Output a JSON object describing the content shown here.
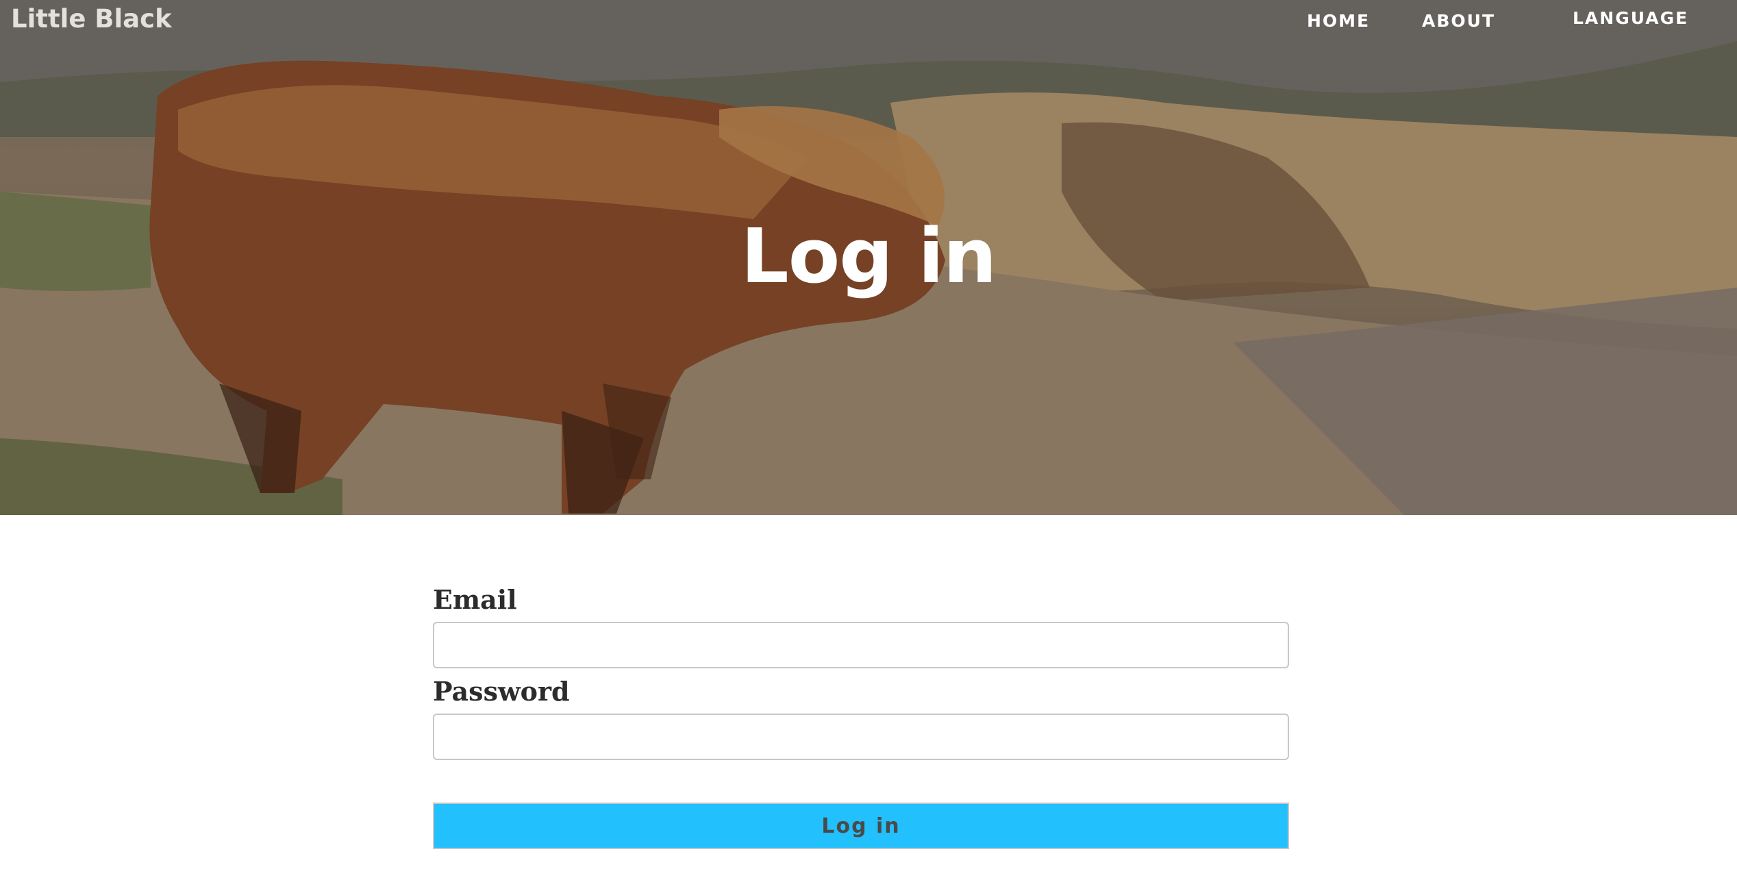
{
  "header": {
    "brand": "Little Black",
    "nav": {
      "home": "HOME",
      "about": "ABOUT",
      "language": "LANGUAGE"
    }
  },
  "hero": {
    "title": "Log in"
  },
  "form": {
    "email_label": "Email",
    "email_value": "",
    "password_label": "Password",
    "password_value": "",
    "submit_label": "Log in"
  },
  "colors": {
    "submit_bg": "#22c0fd",
    "text_dark": "#2c2c2c",
    "hero_text": "#ffffff"
  }
}
